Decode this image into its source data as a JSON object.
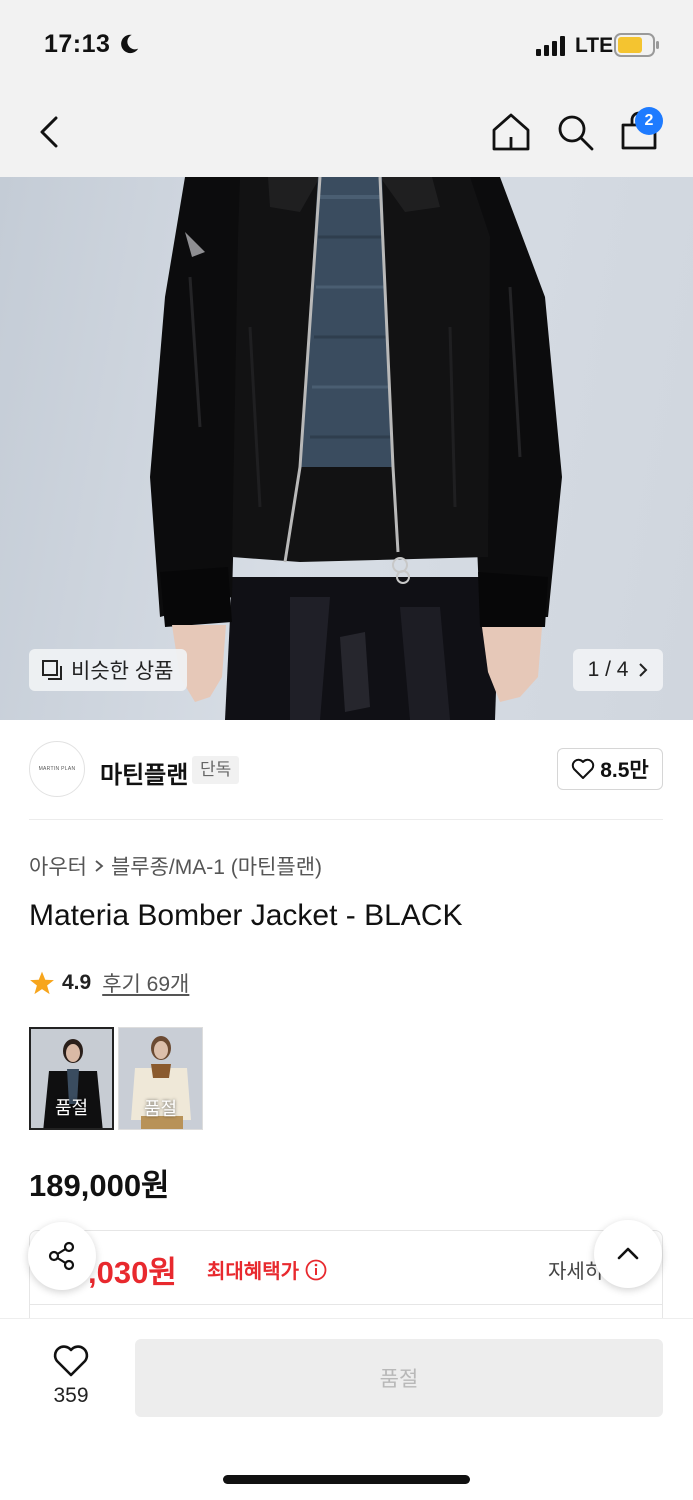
{
  "status_bar": {
    "time": "17:13",
    "network": "LTE",
    "battery_color": "#f4c430"
  },
  "header": {
    "cart_count": "2"
  },
  "gallery": {
    "similar_label": "비슷한 상품",
    "page_indicator": "1 / 4"
  },
  "brand": {
    "logo_text": "MARTIN PLAN",
    "name": "마틴플랜",
    "tag": "단독",
    "like_count": "8.5만"
  },
  "product": {
    "breadcrumb": [
      "아우터",
      "블루종/MA-1 (마틴플랜)"
    ],
    "title": "Materia Bomber Jacket - BLACK",
    "rating": "4.9",
    "review_label": "후기 69개",
    "swatches": [
      {
        "label": "품절",
        "color": "black"
      },
      {
        "label": "품절",
        "color": "ivory"
      }
    ],
    "price": "189,000원"
  },
  "benefit": {
    "price": ",030원",
    "label": "최대혜택가",
    "detail_label": "자세히"
  },
  "bottom_bar": {
    "wish_count": "359",
    "buy_label": "품절"
  },
  "colors": {
    "accent_blue": "#1e7bff",
    "sale_red": "#e8292e",
    "star_orange": "#f7a51c"
  }
}
